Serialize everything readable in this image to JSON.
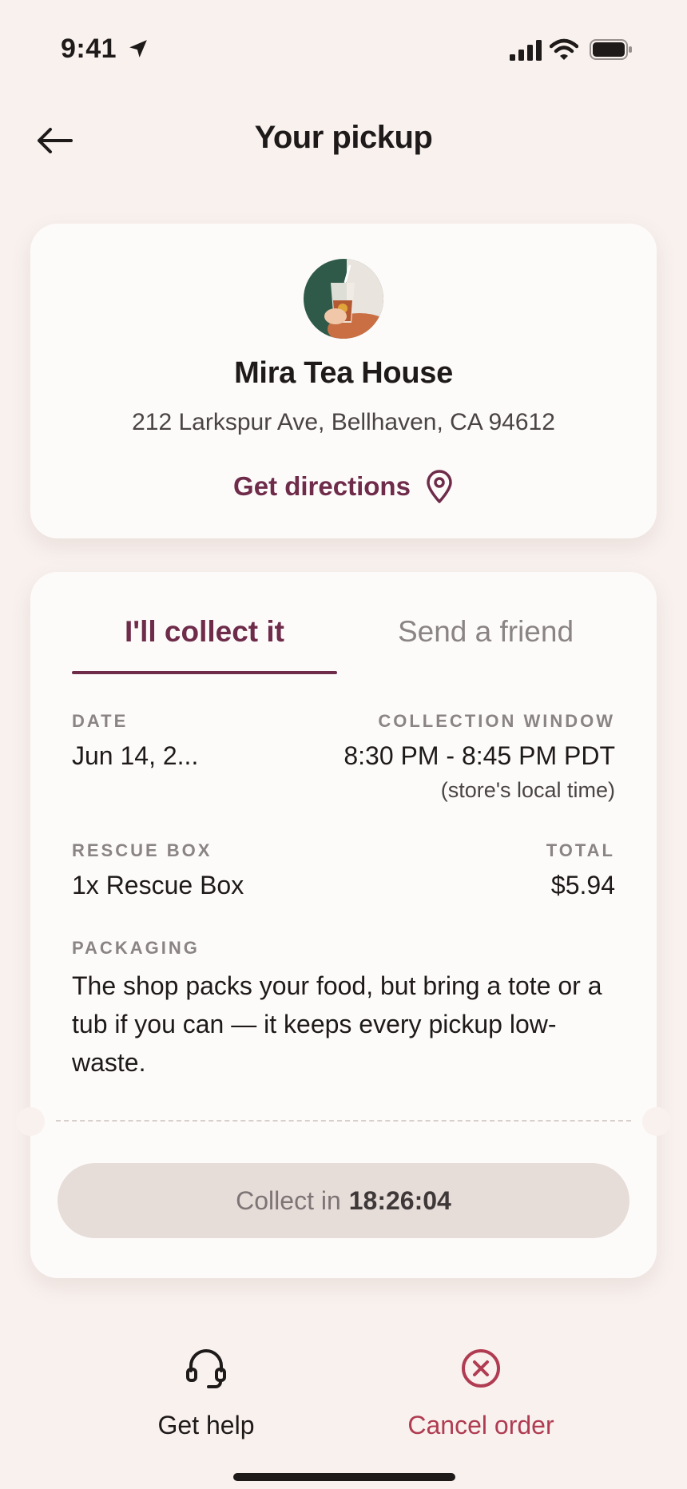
{
  "status_bar": {
    "time": "9:41"
  },
  "header": {
    "title": "Your pickup"
  },
  "store": {
    "name": "Mira Tea House",
    "address": "212 Larkspur Ave, Bellhaven, CA 94612",
    "directions_label": "Get directions"
  },
  "tabs": [
    {
      "label": "I'll collect it",
      "active": true
    },
    {
      "label": "Send a friend",
      "active": false
    }
  ],
  "details": {
    "date_label": "DATE",
    "date_value": "Jun 14, 2...",
    "window_label": "COLLECTION WINDOW",
    "window_value": "8:30 PM - 8:45 PM PDT",
    "window_note": "(store's local time)",
    "box_label": "RESCUE BOX",
    "box_value": "1x Rescue Box",
    "total_label": "TOTAL",
    "total_value": "$5.94",
    "packaging_label": "PACKAGING",
    "packaging_text": "The shop packs your food, but bring a tote or a tub if you can — it keeps every pickup low-waste."
  },
  "collect_button": {
    "prefix": "Collect in",
    "timer": "18:26:04"
  },
  "actions": {
    "help_label": "Get help",
    "cancel_label": "Cancel order"
  },
  "colors": {
    "accent": "#6e2c4a",
    "cancel": "#b03c52",
    "background": "#f8f1ee",
    "card": "#fdfbfa",
    "button_disabled": "#e6dcd8"
  },
  "icons": [
    "location-arrow-icon",
    "signal-icon",
    "wifi-icon",
    "battery-icon",
    "back-arrow-icon",
    "map-pin-icon",
    "headset-icon",
    "cancel-circle-icon"
  ]
}
